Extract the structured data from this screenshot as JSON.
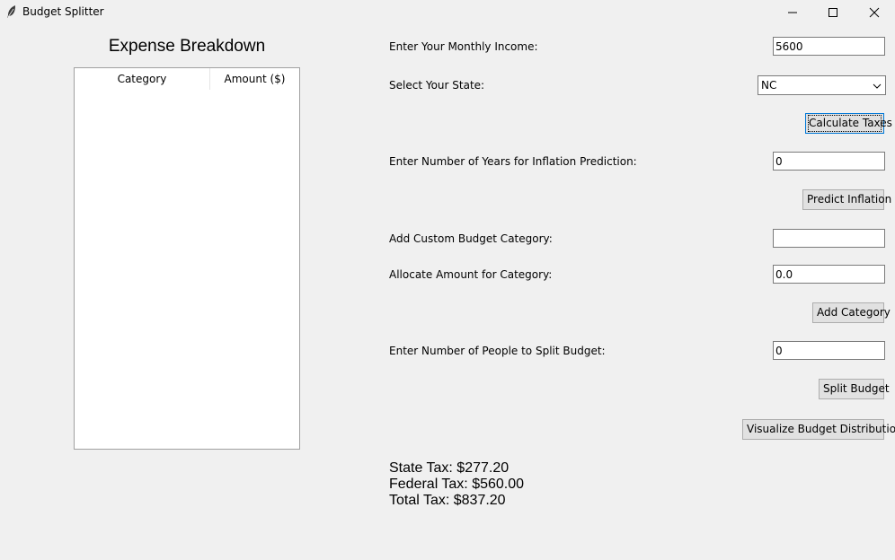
{
  "window": {
    "title": "Budget Splitter",
    "app_icon": "feather-icon",
    "controls": [
      "minimize-icon",
      "maximize-icon",
      "close-icon"
    ]
  },
  "left_panel": {
    "title": "Expense Breakdown",
    "table": {
      "columns": [
        "Category",
        "Amount ($)"
      ],
      "rows": []
    }
  },
  "form": {
    "income": {
      "label": "Enter Your Monthly Income:",
      "value": "5600"
    },
    "state": {
      "label": "Select Your State:",
      "value": "NC"
    },
    "calculate_taxes_label": "Calculate Taxes",
    "inflation": {
      "label": "Enter Number of Years for Inflation Prediction:",
      "value": "0"
    },
    "predict_inflation_label": "Predict Inflation",
    "custom_category": {
      "label": "Add Custom Budget Category:",
      "value": ""
    },
    "allocate_amount": {
      "label": "Allocate Amount for Category:",
      "value": "0.0"
    },
    "add_category_label": "Add Category",
    "split_people": {
      "label": "Enter Number of People to Split Budget:",
      "value": "0"
    },
    "split_budget_label": "Split Budget",
    "visualize_label": "Visualize Budget Distribution"
  },
  "results": {
    "state_tax": "State Tax: $277.20",
    "federal_tax": "Federal Tax: $560.00",
    "total_tax": "Total Tax: $837.20"
  }
}
